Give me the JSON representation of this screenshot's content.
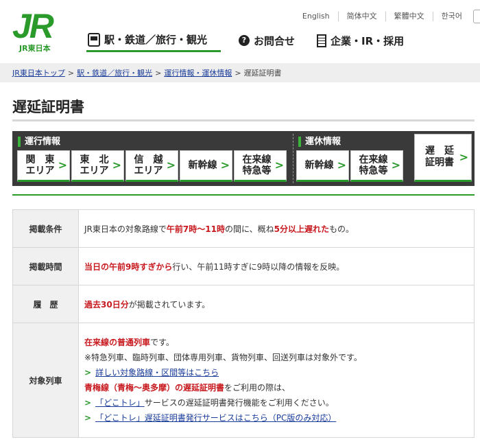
{
  "header": {
    "logo_text": "JR",
    "logo_sub": "JR東日本",
    "languages": [
      "English",
      "简体中文",
      "繁體中文",
      "한국어"
    ],
    "nav": [
      {
        "label": "駅・鉄道／旅行・観光",
        "icon": "train-icon"
      },
      {
        "label": "お問合せ",
        "icon": "question-icon"
      },
      {
        "label": "企業・IR・採用",
        "icon": "building-icon"
      }
    ]
  },
  "breadcrumb": {
    "items": [
      "JR東日本トップ",
      "駅・鉄道／旅行・観光",
      "運行情報・運休情報"
    ],
    "current": "遅延証明書",
    "separator": ">"
  },
  "page": {
    "title": "遅延証明書"
  },
  "panel": {
    "unko_heading": "運行情報",
    "unko_buttons": [
      {
        "line1": "関　東",
        "line2": "エリア"
      },
      {
        "line1": "東　北",
        "line2": "エリア"
      },
      {
        "line1": "信　越",
        "line2": "エリア"
      },
      {
        "line1": "新幹線",
        "line2": ""
      },
      {
        "line1": "在来線",
        "line2": "特急等"
      }
    ],
    "unkyu_heading": "運休情報",
    "unkyu_buttons": [
      {
        "line1": "新幹線",
        "line2": ""
      },
      {
        "line1": "在来線",
        "line2": "特急等"
      }
    ],
    "delay_button": {
      "line1": "遅　延",
      "line2": "証明書"
    },
    "chevron": ">"
  },
  "table": {
    "rows": [
      {
        "header": "掲載条件",
        "parts": [
          {
            "text": "JR東日本の対象路線で",
            "red": false
          },
          {
            "text": "午前7時～11時",
            "red": true
          },
          {
            "text": "の間に、概ね",
            "red": false
          },
          {
            "text": "5分以上遅れた",
            "red": true
          },
          {
            "text": "もの。",
            "red": false
          }
        ]
      },
      {
        "header": "掲載時間",
        "parts": [
          {
            "text": "当日の午前9時すぎから",
            "red": true
          },
          {
            "text": "行い、午前11時すぎに9時以降の情報を反映。",
            "red": false
          }
        ]
      },
      {
        "header": "履　歴",
        "parts": [
          {
            "text": "過去30日分",
            "red": true
          },
          {
            "text": "が掲載されています。",
            "red": false
          }
        ]
      }
    ],
    "target": {
      "header": "対象列車",
      "line1_red": "在来線の普通列車",
      "line1_rest": "です。",
      "line2": "※特急列車、臨時列車、団体専用列車、貨物列車、回送列車は対象外です。",
      "link1": "詳しい対象路線・区間等はこちら",
      "line4_red": "青梅線（青梅～奥多摩）の遅延証明書",
      "line4_rest": "をご利用の際は、",
      "link2_text": "「どこトレ」",
      "link2_rest": "サービスの遅延証明書発行機能をご利用ください。",
      "link3": "「どこトレ」遅延証明書発行サービスはこちら（PC版のみ対応）"
    }
  }
}
